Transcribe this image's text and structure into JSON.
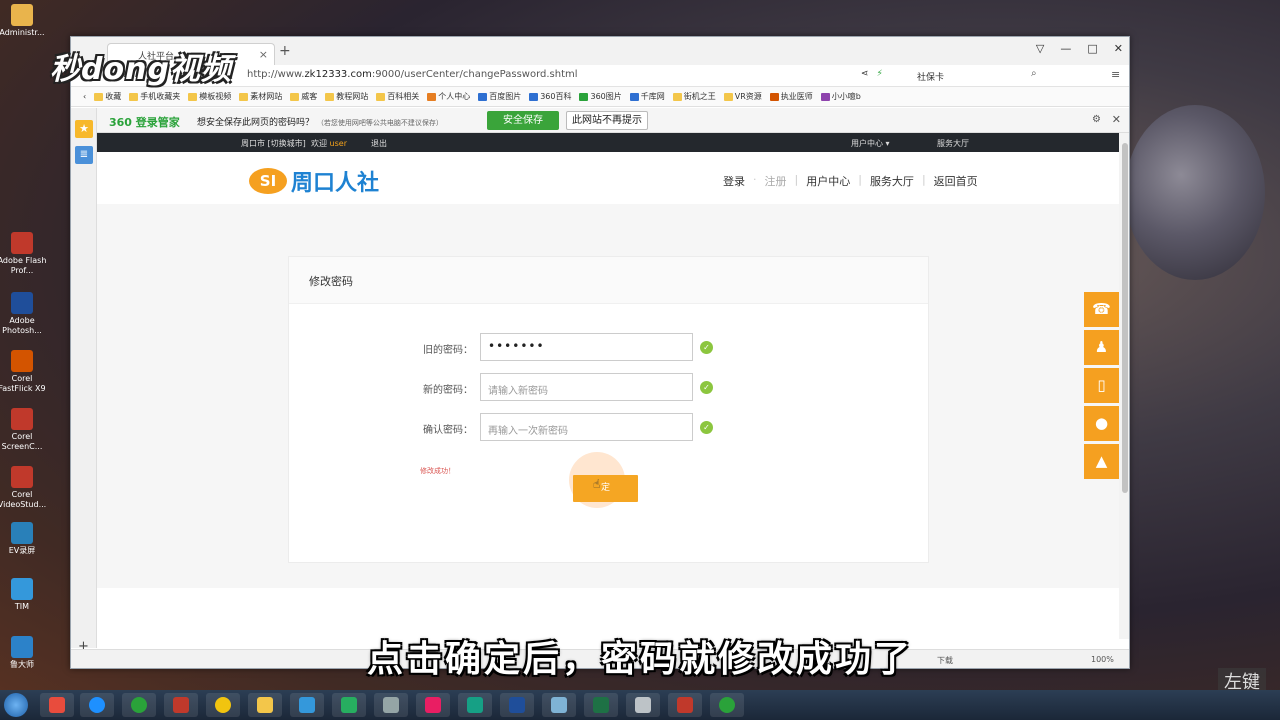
{
  "overlay": {
    "watermark": "秒dong视频",
    "subtitle": "点击确定后，密码就修改成功了",
    "corner_tag": "左键"
  },
  "desktop": {
    "icons": [
      "Administr...",
      "Adobe Flash Prof...",
      "Adobe Photosh...",
      "Corel FastFlick X9",
      "Corel ScreenC...",
      "Corel VideoStud...",
      "EV录屏",
      "TIM",
      "鲁大师"
    ]
  },
  "browser": {
    "tab_title": "人社平台...",
    "url_prefix": "http://www.",
    "url_host": "zk12333.com",
    "url_rest": ":9000/userCenter/changePassword.shtml",
    "search_text": "社保卡",
    "bookmarks": [
      "收藏",
      "手机收藏夹",
      "模板视频",
      "素材网站",
      "威客",
      "教程网站",
      "百科相关",
      "个人中心",
      "百度图片",
      "360百科",
      "360图片",
      "千库网",
      "街机之王",
      "VR资源",
      "执业医师",
      "小小噫b"
    ],
    "notify": {
      "brand": "360 登录管家",
      "question": "想安全保存此网页的密码吗？",
      "note": "（若您使用网吧等公共电脑不建议保存）",
      "save_button": "安全保存",
      "noprompt_button": "此网站不再提示"
    },
    "status": {
      "download": "下载",
      "zoom": "100%"
    }
  },
  "site": {
    "topbar": {
      "city": "周口市 [切换城市]",
      "welcome_prefix": "欢迎",
      "welcome_user": "user",
      "logout": "退出",
      "user_center": "用户中心 ▾",
      "service_hall": "服务大厅"
    },
    "logo_text": "周口人社",
    "nav": {
      "login": "登录",
      "register": "注册",
      "user_center": "用户中心",
      "service_hall": "服务大厅",
      "home": "返回首页"
    },
    "form": {
      "title": "修改密码",
      "old_label": "旧的密码：",
      "old_value": "•••••••",
      "new_label": "新的密码：",
      "new_placeholder": "请输入新密码",
      "confirm_label": "确认密码：",
      "confirm_placeholder": "再输入一次新密码",
      "success_text": "修改成功！",
      "submit_label": "定"
    }
  }
}
